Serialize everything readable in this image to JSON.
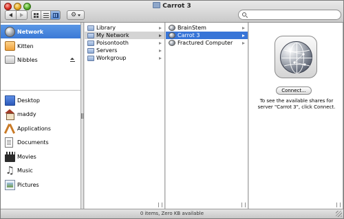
{
  "window": {
    "title": "Carrot 3"
  },
  "toolbar": {
    "back_icon": "chevron-left-icon",
    "forward_icon": "chevron-right-icon",
    "view_modes": [
      "icon-view",
      "list-view",
      "column-view"
    ],
    "active_view": "column-view",
    "action_icon": "gear-icon",
    "search": {
      "value": "",
      "placeholder": ""
    }
  },
  "sidebar": {
    "devices": [
      {
        "label": "Network",
        "icon": "network-globe-icon",
        "selected": true
      },
      {
        "label": "Kitten",
        "icon": "hard-drive-icon"
      },
      {
        "label": "Nibbles",
        "icon": "hard-drive-icon",
        "eject": true
      }
    ],
    "places": [
      {
        "label": "Desktop",
        "icon": "desktop-icon"
      },
      {
        "label": "maddy",
        "icon": "home-icon"
      },
      {
        "label": "Applications",
        "icon": "applications-icon"
      },
      {
        "label": "Documents",
        "icon": "documents-icon"
      },
      {
        "label": "Movies",
        "icon": "movies-icon"
      },
      {
        "label": "Music",
        "icon": "music-icon"
      },
      {
        "label": "Pictures",
        "icon": "pictures-icon"
      }
    ]
  },
  "columns": {
    "col1": [
      {
        "label": "Library",
        "arrow": true
      },
      {
        "label": "My Network",
        "arrow": true,
        "selected": true
      },
      {
        "label": "Poisontooth",
        "arrow": true
      },
      {
        "label": "Servers",
        "arrow": true
      },
      {
        "label": "Workgroup",
        "arrow": true
      }
    ],
    "col2": [
      {
        "label": "BrainStem",
        "arrow": true
      },
      {
        "label": "Carrot 3",
        "arrow": true,
        "selected": true
      },
      {
        "label": "Fractured Computer",
        "arrow": true
      }
    ]
  },
  "preview": {
    "icon": "network-server-icon",
    "connect_label": "Connect...",
    "message": "To see the available shares for server \"Carrot 3\", click Connect."
  },
  "status": {
    "text": "0 items, Zero KB available"
  },
  "colors": {
    "selection_blue": "#3875d7",
    "sidebar_selection": "#4b89de"
  }
}
